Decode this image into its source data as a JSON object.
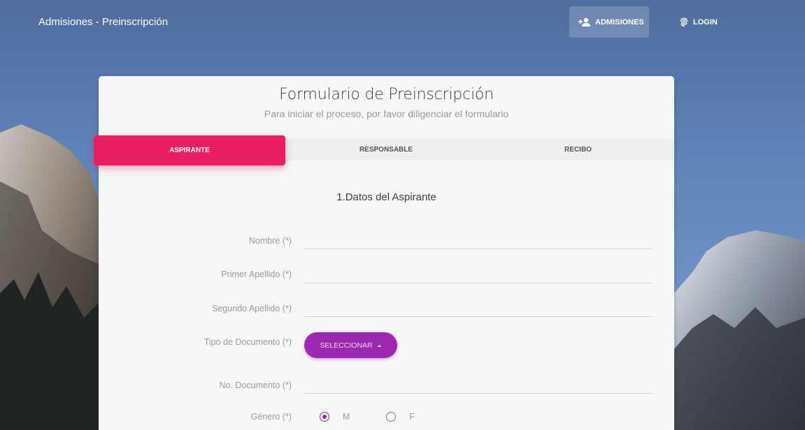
{
  "navbar": {
    "brand": "Admisiones - Preinscripción",
    "links": [
      {
        "label": "ADMISIONES",
        "icon": "person-add-icon",
        "active": true
      },
      {
        "label": "LOGIN",
        "icon": "fingerprint-icon",
        "active": false
      }
    ]
  },
  "form": {
    "title": "Formulario de Preinscripción",
    "subtitle": "Para iniciar el proceso, por favor diligenciar el formulario",
    "tabs": [
      {
        "label": "ASPIRANTE",
        "active": true
      },
      {
        "label": "RESPONSABLE",
        "active": false
      },
      {
        "label": "RECIBO",
        "active": false
      }
    ],
    "section_title": "1.Datos del Aspirante",
    "fields": {
      "nombre": {
        "label": "Nombre (*)",
        "value": ""
      },
      "primer_apellido": {
        "label": "Primer Apellido (*)",
        "value": ""
      },
      "segundo_apellido": {
        "label": "Segundo Apellido (*)",
        "value": ""
      },
      "tipo_documento": {
        "label": "Tipo de Documento (*)",
        "button_label": "SELECCIONAR",
        "icon": "caret-up-icon"
      },
      "no_documento": {
        "label": "No. Documento (*)",
        "value": ""
      },
      "genero": {
        "label": "Género (*)",
        "options": [
          {
            "label": "M",
            "checked": true
          },
          {
            "label": "F",
            "checked": false
          }
        ]
      }
    }
  },
  "colors": {
    "accent_pink": "#e91e63",
    "accent_purple": "#9c27b0",
    "card_bg": "#f7f7f7"
  }
}
